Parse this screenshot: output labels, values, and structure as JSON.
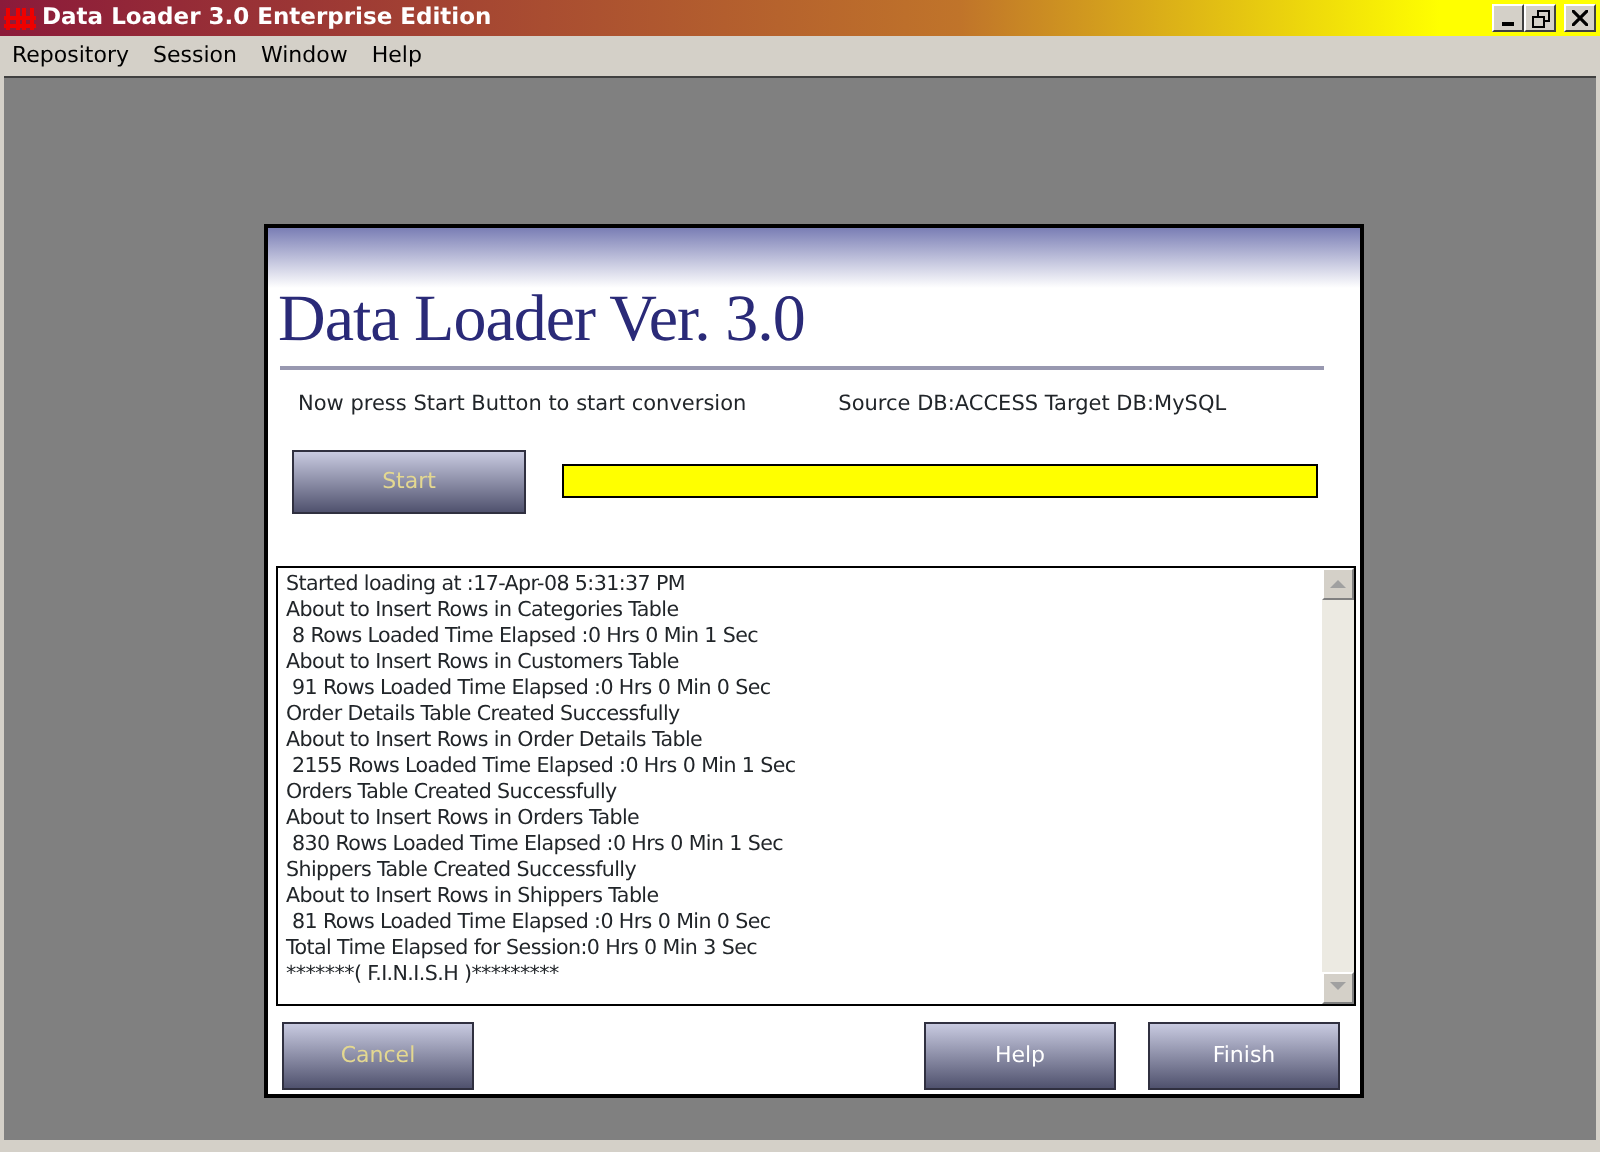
{
  "window": {
    "title": "Data Loader 3.0 Enterprise Edition"
  },
  "menu": [
    "Repository",
    "Session",
    "Window",
    "Help"
  ],
  "dialog": {
    "heading": "Data Loader Ver. 3.0",
    "instruction": "Now press Start Button to start conversion",
    "db_info": "Source DB:ACCESS Target DB:MySQL",
    "start_button": {
      "label": "Start",
      "disabled": true
    },
    "progress": {
      "level": 1
    },
    "log": [
      "Started loading at :17-Apr-08 5:31:37 PM",
      "About to Insert Rows in Categories Table",
      " 8 Rows Loaded Time Elapsed :0 Hrs 0 Min 1 Sec",
      "About to Insert Rows in Customers Table",
      " 91 Rows Loaded Time Elapsed :0 Hrs 0 Min 0 Sec",
      "Order Details Table Created Successfully",
      "About to Insert Rows in Order Details Table",
      " 2155 Rows Loaded Time Elapsed :0 Hrs 0 Min 1 Sec",
      "Orders Table Created Successfully",
      "About to Insert Rows in Orders Table",
      " 830 Rows Loaded Time Elapsed :0 Hrs 0 Min 1 Sec",
      "Shippers Table Created Successfully",
      "About to Insert Rows in Shippers Table",
      " 81 Rows Loaded Time Elapsed :0 Hrs 0 Min 0 Sec",
      "Total Time Elapsed for Session:0 Hrs 0 Min 3 Sec",
      "*******( F.I.N.I.S.H )*********"
    ],
    "buttons": [
      {
        "label": "Cancel",
        "disabled": true
      },
      {
        "label": "Help",
        "disabled": false
      },
      {
        "label": "Finish",
        "disabled": false
      }
    ]
  }
}
